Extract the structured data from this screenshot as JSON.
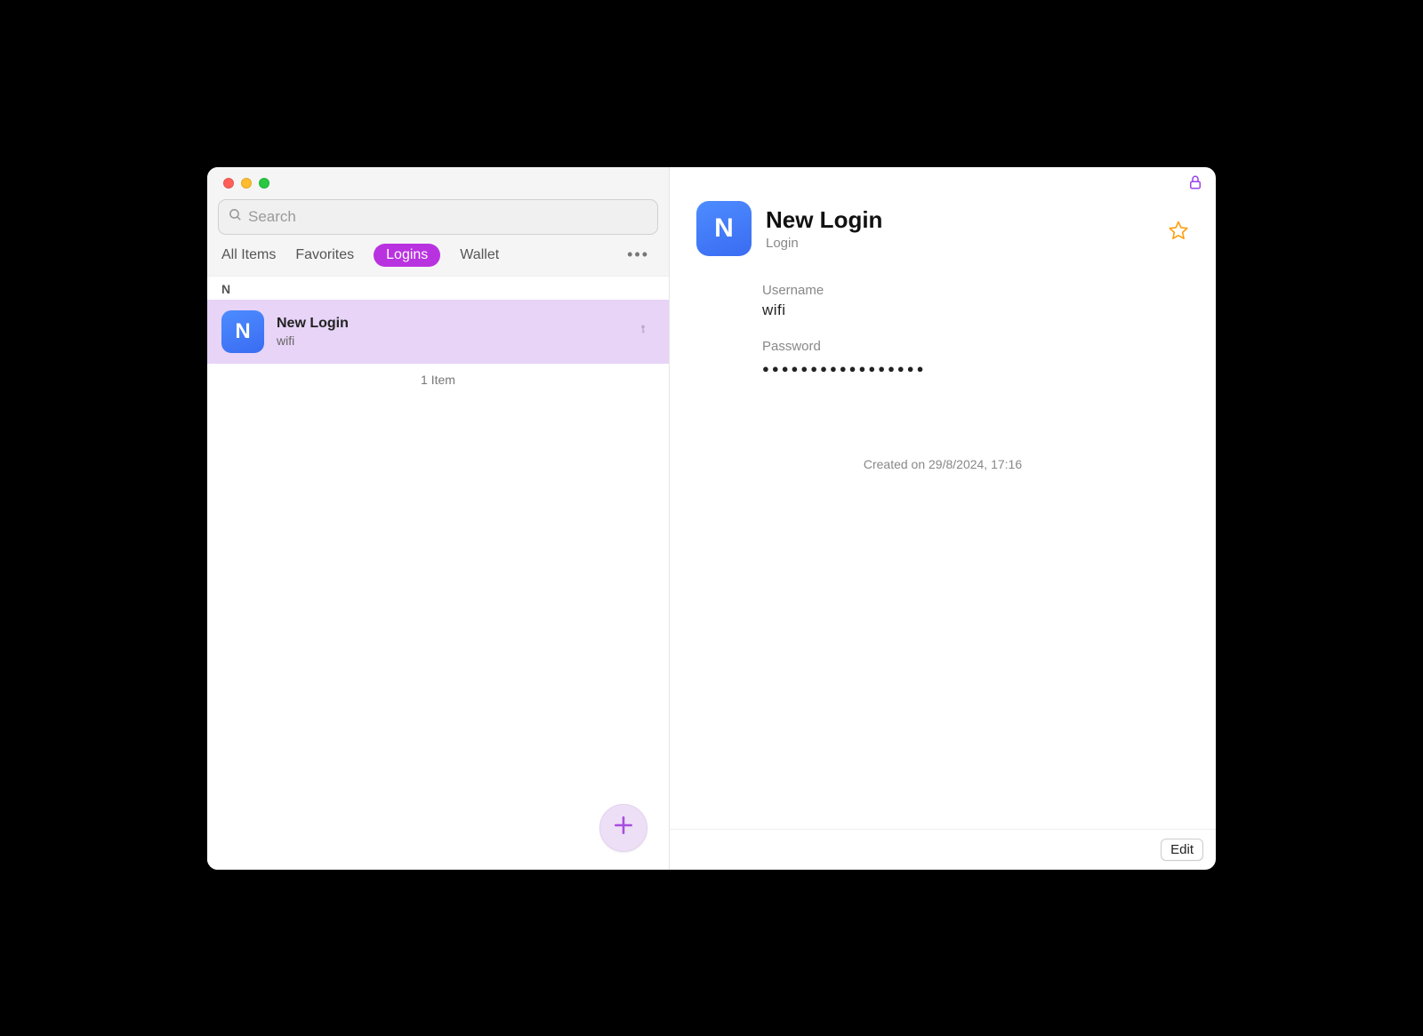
{
  "search": {
    "placeholder": "Search"
  },
  "tabs": {
    "all": "All Items",
    "favorites": "Favorites",
    "logins": "Logins",
    "wallet": "Wallet"
  },
  "list": {
    "section_letter": "N",
    "items": [
      {
        "initial": "N",
        "title": "New Login",
        "subtitle": "wifi"
      }
    ],
    "count_label": "1 Item"
  },
  "detail": {
    "icon_initial": "N",
    "title": "New Login",
    "type": "Login",
    "username_label": "Username",
    "username_value": "wifi",
    "password_label": "Password",
    "password_mask": "●●●●●●●●●●●●●●●●●",
    "created_label": "Created on 29/8/2024, 17:16",
    "edit_label": "Edit"
  }
}
